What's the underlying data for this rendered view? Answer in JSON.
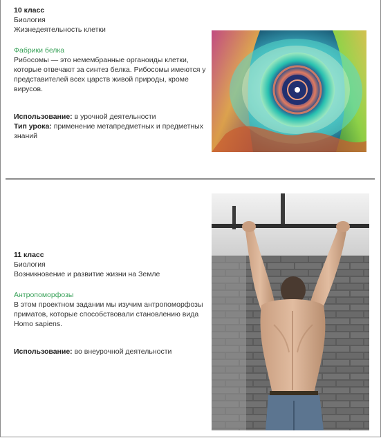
{
  "cards": [
    {
      "grade": "10 класс",
      "subject": "Биология",
      "topic": "Жизнедеятельность клетки",
      "project_title": "Фабрики белка",
      "description": "Рибосомы — это немембранные органоиды клетки, которые отвечают за синтез белка. Рибосомы имеются у представителей всех царств живой природы, кроме вирусов.",
      "usage_label": "Использование:",
      "usage_value": " в урочной деятельности",
      "lesson_type_label": "Тип урока:",
      "lesson_type_value": " применение метапредметных и предметных знаний"
    },
    {
      "grade": "11 класс",
      "subject": "Биология",
      "topic": "Возникновение и развитие жизни на Земле",
      "project_title": "Антропоморфозы",
      "description": "В этом проектном задании мы изучим антропоморфозы приматов, которые способствовали становлению вида Homo sapiens.",
      "usage_label": "Использование:",
      "usage_value": " во внеурочной деятельности"
    }
  ],
  "colors": {
    "accent": "#3aa25a",
    "text": "#333333",
    "divider": "#8c8c8c"
  }
}
